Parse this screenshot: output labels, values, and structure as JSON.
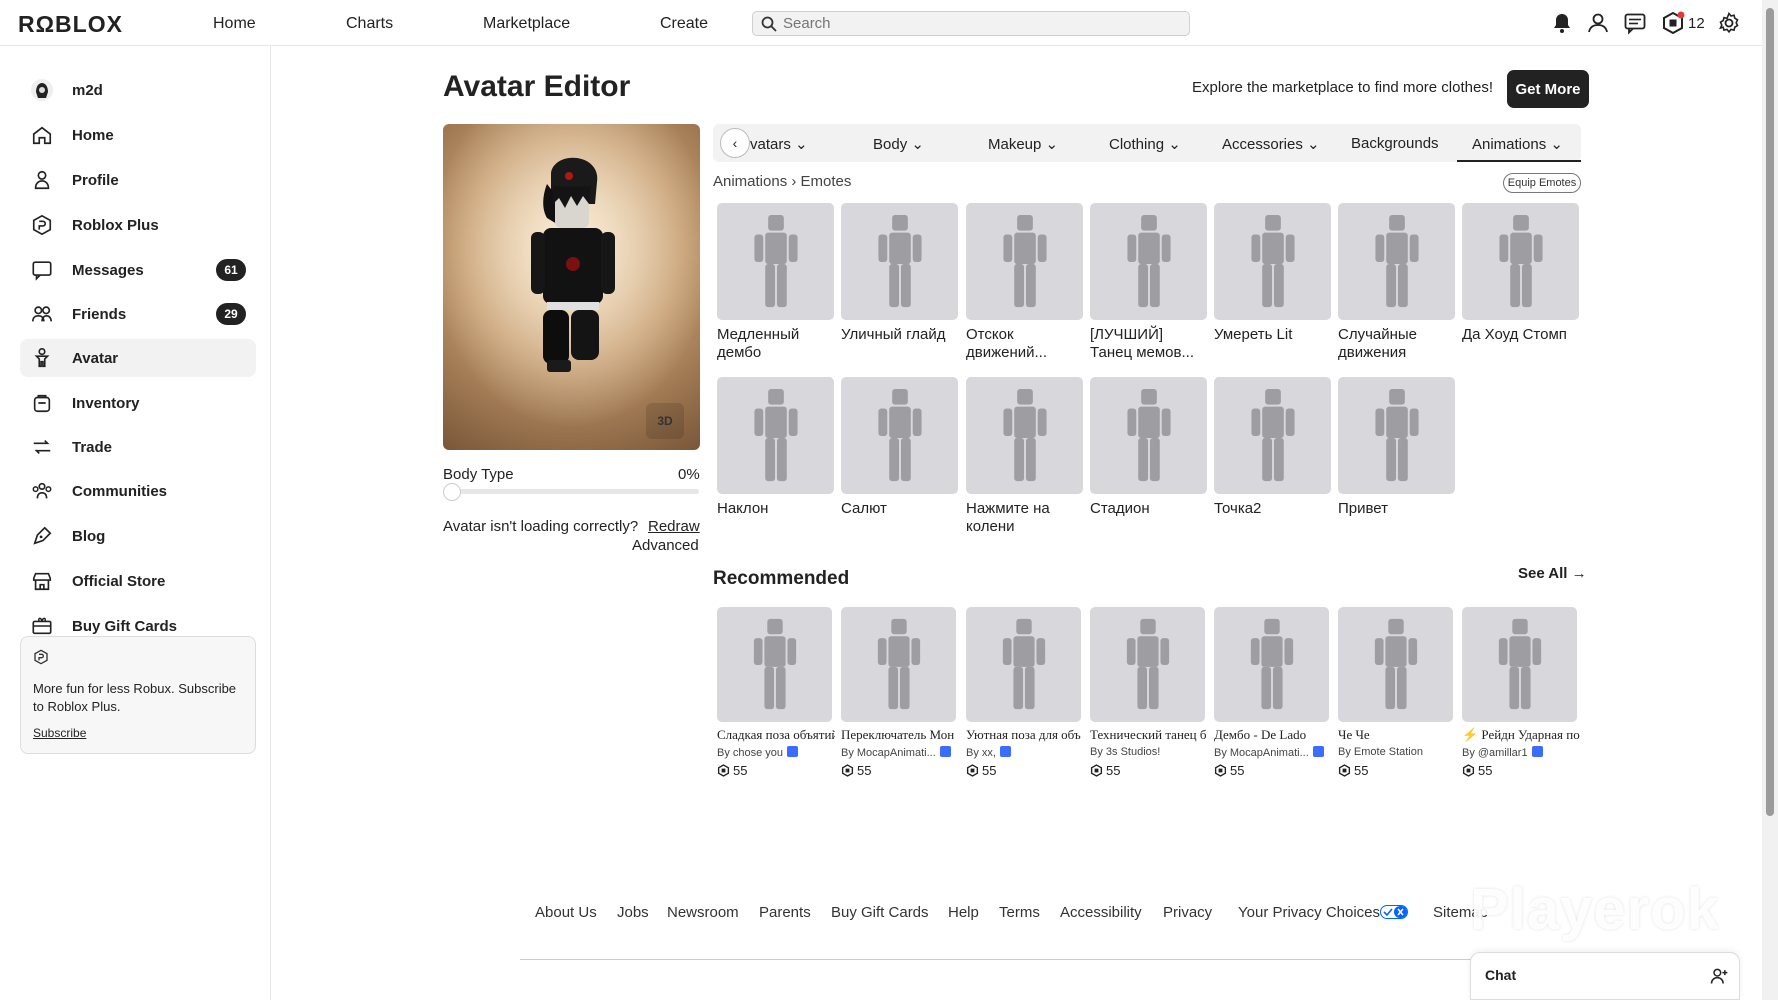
{
  "topbar": {
    "logo": "RΩBLOX",
    "nav": [
      "Home",
      "Charts",
      "Marketplace",
      "Create"
    ],
    "search_placeholder": "Search",
    "robux": "12"
  },
  "sidebar": {
    "user": "m2d",
    "items": [
      {
        "label": "Home",
        "badge": ""
      },
      {
        "label": "Profile",
        "badge": ""
      },
      {
        "label": "Roblox Plus",
        "badge": ""
      },
      {
        "label": "Messages",
        "badge": "61"
      },
      {
        "label": "Friends",
        "badge": "29"
      },
      {
        "label": "Avatar",
        "badge": ""
      },
      {
        "label": "Inventory",
        "badge": ""
      },
      {
        "label": "Trade",
        "badge": ""
      },
      {
        "label": "Communities",
        "badge": ""
      },
      {
        "label": "Blog",
        "badge": ""
      },
      {
        "label": "Official Store",
        "badge": ""
      },
      {
        "label": "Buy Gift Cards",
        "badge": ""
      }
    ],
    "plus_card": {
      "text": "More fun for less Robux. Subscribe to Roblox Plus.",
      "link": "Subscribe"
    }
  },
  "editor": {
    "title": "Avatar Editor",
    "promo": "Explore the marketplace to find more clothes!",
    "get_more": "Get More",
    "btn_3d": "3D",
    "body_type_label": "Body Type",
    "body_type_value": "0%",
    "body_type_level": 0,
    "loading_question": "Avatar isn't loading correctly?",
    "redraw": "Redraw",
    "advanced": "Advanced"
  },
  "tabs": {
    "prev": "‹",
    "items": [
      "vatars",
      "Body",
      "Makeup",
      "Clothing",
      "Accessories",
      "Backgrounds",
      "Animations"
    ],
    "active": "Animations"
  },
  "breadcrumb": {
    "parent": "Animations",
    "sep": "›",
    "current": "Emotes"
  },
  "equip_emotes": "Equip Emotes",
  "emotes": [
    "Медленный дембо",
    "Уличный глайд",
    "Отскок движений...",
    "[ЛУЧШИЙ] Танец мемов...",
    "Умереть Lit",
    "Случайные движения",
    "Да Хоуд Стомп",
    "Наклон",
    "Салют",
    "Нажмите на колени",
    "Стадион",
    "Точка2",
    "Привет"
  ],
  "recommended": {
    "title": "Recommended",
    "see_all": "See All →",
    "items": [
      {
        "name": "Сладкая поза объятий",
        "by": "By chose you",
        "verified": true,
        "price": "55"
      },
      {
        "name": "Переключатель Мон",
        "by": "By MocapAnimati...",
        "verified": true,
        "price": "55"
      },
      {
        "name": "Уютная поза для объ",
        "by": "By xx,",
        "verified": true,
        "price": "55"
      },
      {
        "name": "Технический танец б",
        "by": "By 3s Studios!",
        "verified": false,
        "price": "55"
      },
      {
        "name": "Дембо - De Lado",
        "by": "By MocapAnimati...",
        "verified": true,
        "price": "55"
      },
      {
        "name": "Че Че",
        "by": "By Emote Station",
        "verified": false,
        "price": "55"
      },
      {
        "name": "⚡ Рейдн Ударная по",
        "by": "By @amillar1",
        "verified": true,
        "price": "55"
      }
    ]
  },
  "footer": {
    "links": [
      "About Us",
      "Jobs",
      "Newsroom",
      "Parents",
      "Buy Gift Cards",
      "Help",
      "Terms",
      "Accessibility",
      "Privacy",
      "Your Privacy Choices",
      "Sitemap"
    ]
  },
  "watermark": "Playerok",
  "chat": {
    "label": "Chat"
  },
  "colors": {
    "accent": "#222222",
    "tile": "#d8d8dc",
    "verified": "#3b6bff"
  }
}
